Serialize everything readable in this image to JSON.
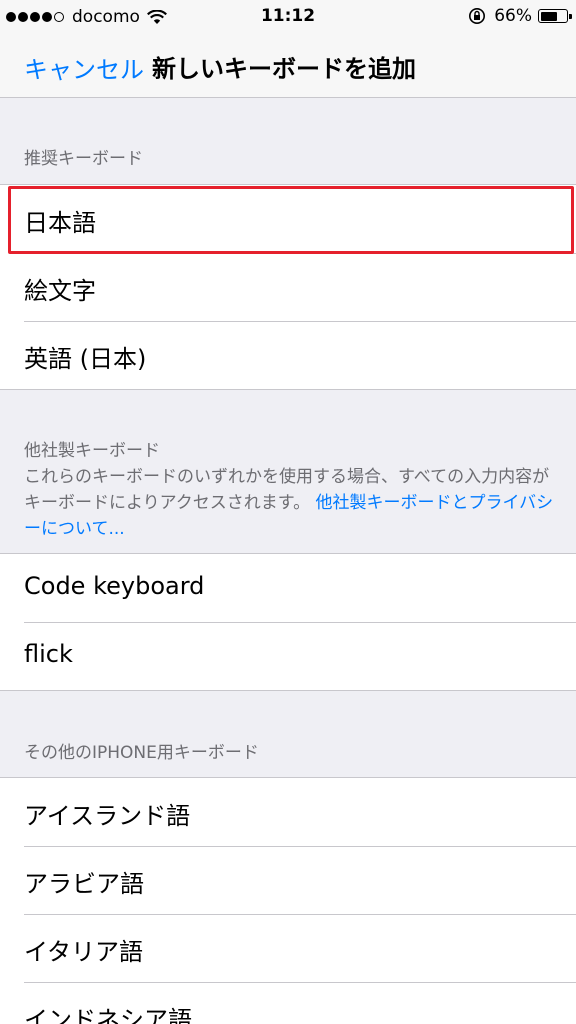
{
  "status_bar": {
    "carrier": "docomo",
    "time": "11:12",
    "battery_percent": "66%",
    "battery_level": 0.66,
    "signal_bars": 4,
    "icons": [
      "signal-dots-icon",
      "wifi-icon",
      "rotation-lock-icon",
      "battery-icon"
    ]
  },
  "nav": {
    "cancel": "キャンセル",
    "title": "新しいキーボードを追加"
  },
  "sections": {
    "recommended": {
      "header": "推奨キーボード",
      "items": [
        "日本語",
        "絵文字",
        "英語 (日本)"
      ]
    },
    "third_party": {
      "header": "他社製キーボード",
      "description": "これらのキーボードのいずれかを使用する場合、すべての入力内容がキーボードによりアクセスされます。",
      "link": "他社製キーボードとプライバシーについて...",
      "items": [
        "Code keyboard",
        "flick"
      ]
    },
    "other": {
      "header": "その他のIPHONE用キーボード",
      "items": [
        "アイスランド語",
        "アラビア語",
        "イタリア語",
        "インドネシア語"
      ]
    }
  },
  "colors": {
    "accent": "#007aff",
    "highlight": "#e5202c",
    "background": "#efeff4"
  }
}
